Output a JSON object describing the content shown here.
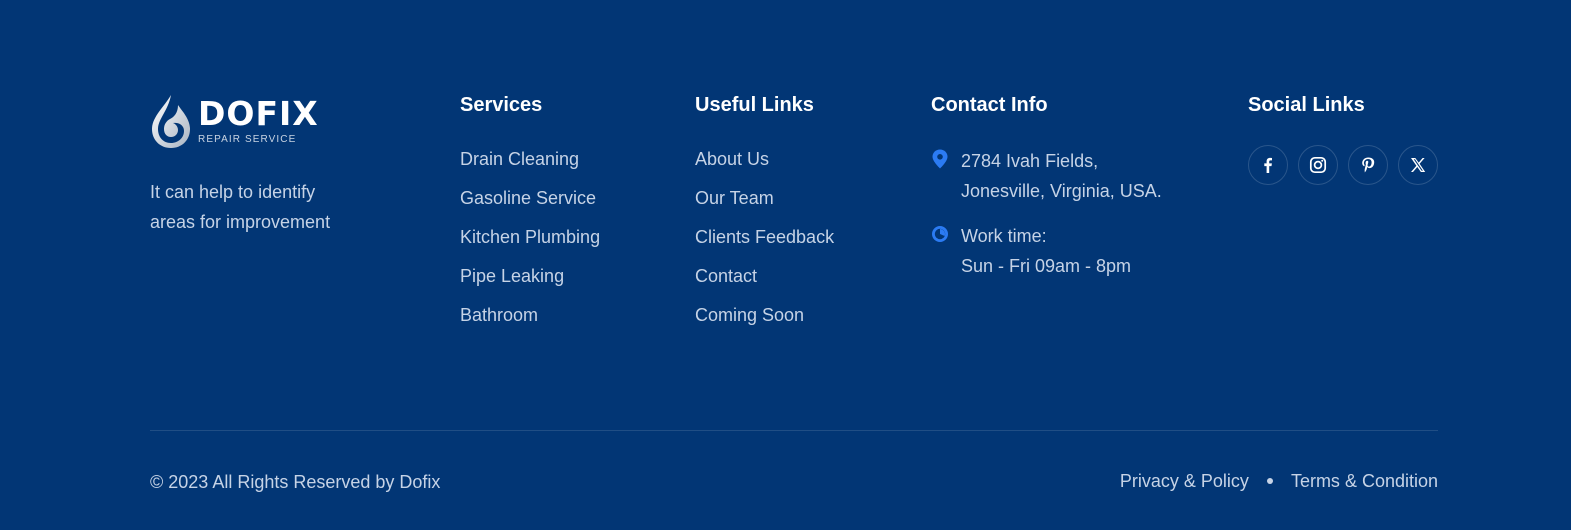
{
  "brand": {
    "name": "DOFIX",
    "tagline": "REPAIR SERVICE",
    "description": "It can help to identify areas for improvement"
  },
  "services": {
    "title": "Services",
    "items": [
      "Drain Cleaning",
      "Gasoline Service",
      "Kitchen Plumbing",
      "Pipe Leaking",
      "Bathroom"
    ]
  },
  "useful_links": {
    "title": "Useful Links",
    "items": [
      "About Us",
      "Our Team",
      "Clients Feedback",
      "Contact",
      "Coming Soon"
    ]
  },
  "contact": {
    "title": "Contact Info",
    "address_line1": "2784 Ivah Fields,",
    "address_line2": "Jonesville, Virginia, USA.",
    "address_icon": "location-pin-icon",
    "work_label": "Work time:",
    "work_hours": "Sun - Fri 09am - 8pm",
    "work_icon": "clock-icon",
    "icon_color": "#2b7bf3"
  },
  "social": {
    "title": "Social Links",
    "icons": [
      "facebook-icon",
      "instagram-icon",
      "pinterest-icon",
      "x-twitter-icon"
    ]
  },
  "bottom": {
    "copyright": "© 2023 All Rights Reserved by Dofix",
    "privacy": "Privacy & Policy",
    "terms": "Terms & Condition"
  },
  "colors": {
    "background": "#023675",
    "text": "#c6d3e6",
    "heading": "#ffffff"
  }
}
